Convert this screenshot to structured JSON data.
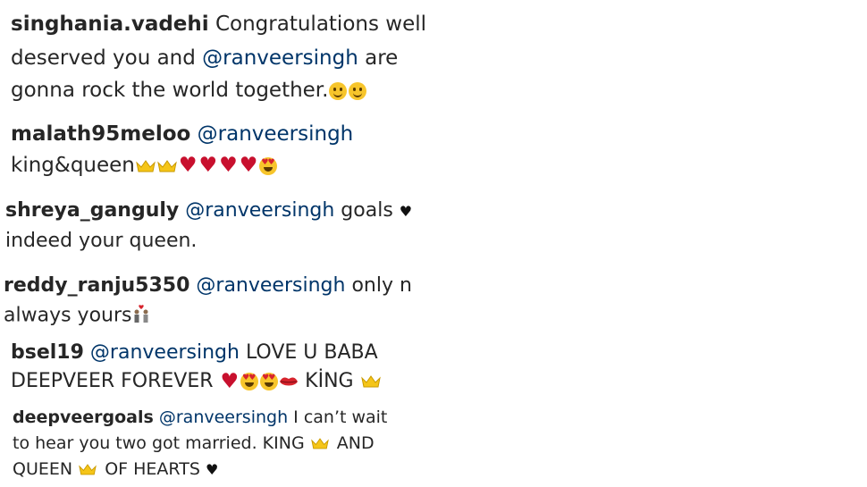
{
  "comments": [
    {
      "username": "singhania.vadehi",
      "line1": "Congratulations well",
      "line2_a": "deserved you and",
      "line2_mention": "@ranveersingh",
      "line2_b": "are",
      "line3": "gonna rock the world together.",
      "emoji": [
        "smiling-face",
        "smiling-face"
      ]
    },
    {
      "username": "malath95meloo",
      "mention": "@ranveersingh",
      "line2": "king&queen",
      "emoji": [
        "crown",
        "crown",
        "red-heart",
        "red-heart",
        "red-heart",
        "red-heart",
        "heart-eyes"
      ]
    },
    {
      "username": "shreya_ganguly",
      "mention": "@ranveersingh",
      "text1": "goals",
      "line2": "indeed your queen.",
      "emoji": [
        "black-heart"
      ]
    },
    {
      "username": "reddy_ranju5350",
      "mention": "@ranveersingh",
      "text1": "only n",
      "line2": "always yours",
      "emoji": [
        "couple-with-heart"
      ]
    },
    {
      "username": "bsel19",
      "mention": "@ranveersingh",
      "text1": "LOVE U BABA",
      "line2_a": "DEEPVEER FOREVER",
      "line2_b": "KİNG",
      "emoji": [
        "red-heart",
        "heart-eyes",
        "heart-eyes",
        "kiss-lips",
        "crown"
      ]
    },
    {
      "username": "deepveergoals",
      "mention": "@ranveersingh",
      "text1": "I can’t wait",
      "line2_a": "to hear you two got married. KING",
      "line2_b": "AND",
      "line3_a": "QUEEN",
      "line3_b": "OF HEARTS",
      "emoji": [
        "crown",
        "crown",
        "black-heart"
      ]
    }
  ],
  "colors": {
    "text": "#262626",
    "mention": "#003569",
    "red_heart": "#c8102e",
    "emoji_yellow": "#f7c52b"
  }
}
